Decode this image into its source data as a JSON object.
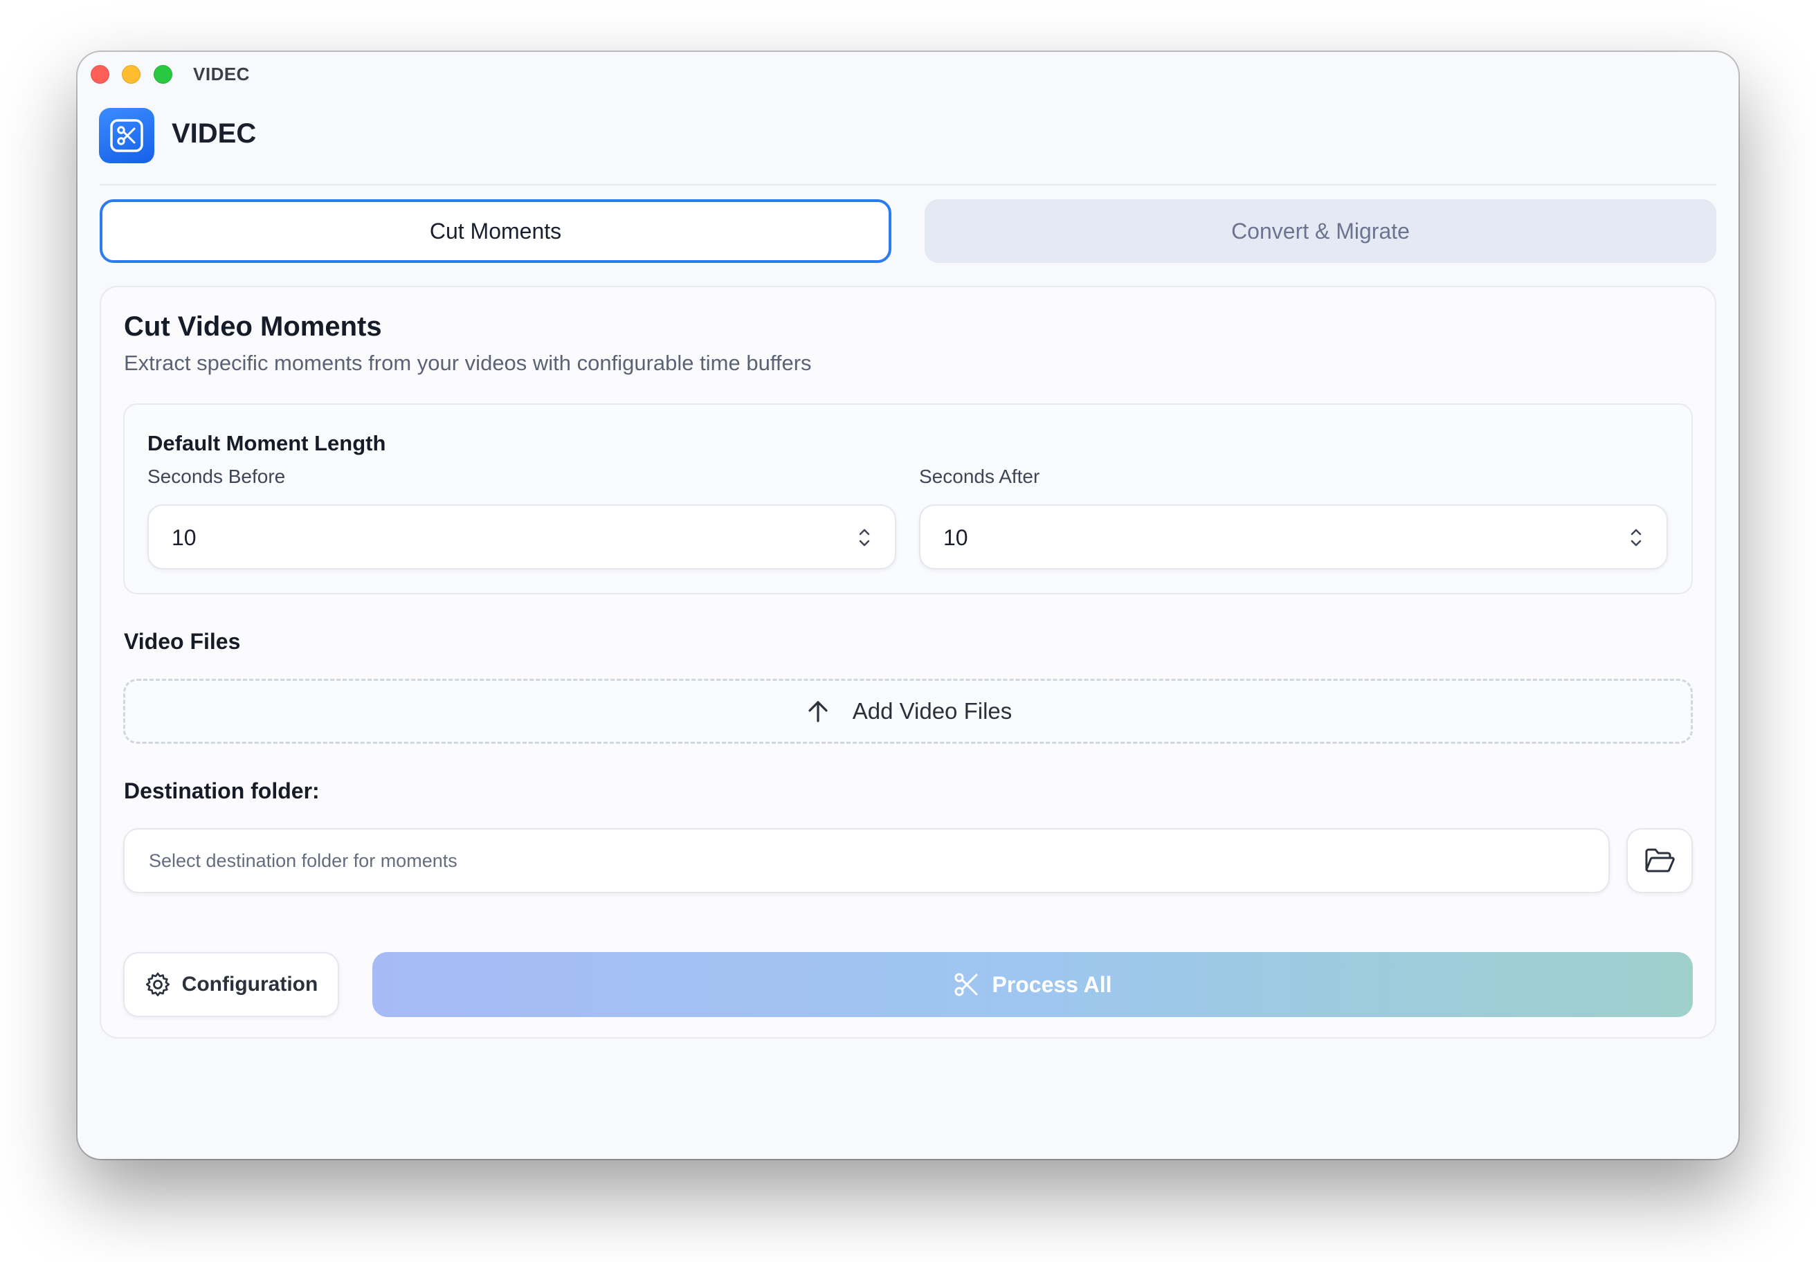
{
  "window": {
    "title": "VIDEC"
  },
  "app": {
    "name": "VIDEC"
  },
  "tabs": [
    {
      "label": "Cut Moments",
      "active": true
    },
    {
      "label": "Convert & Migrate",
      "active": false
    }
  ],
  "card": {
    "title": "Cut Video Moments",
    "subtitle": "Extract specific moments from your videos with configurable time buffers"
  },
  "settings": {
    "title": "Default Moment Length",
    "seconds_before": {
      "label": "Seconds Before",
      "value": "10"
    },
    "seconds_after": {
      "label": "Seconds After",
      "value": "10"
    }
  },
  "video_files": {
    "label": "Video Files",
    "add_label": "Add Video Files"
  },
  "destination": {
    "label": "Destination folder:",
    "placeholder": "Select destination folder for moments"
  },
  "actions": {
    "configuration_label": "Configuration",
    "process_label": "Process All"
  },
  "icons": {
    "logo": "scissors-icon",
    "stepper": "chevron-up-down-icon",
    "upload": "arrow-up-icon",
    "folder": "folder-open-icon",
    "config": "gear-icon",
    "process": "scissors-icon"
  },
  "colors": {
    "accent": "#2d7bf0",
    "logo_bg": "#1e6ef0",
    "process_gradient_start": "#a6bbf6",
    "process_gradient_end": "#9fd0cc",
    "traffic_red": "#fe5f57",
    "traffic_yellow": "#febc2e",
    "traffic_green": "#28c840"
  }
}
